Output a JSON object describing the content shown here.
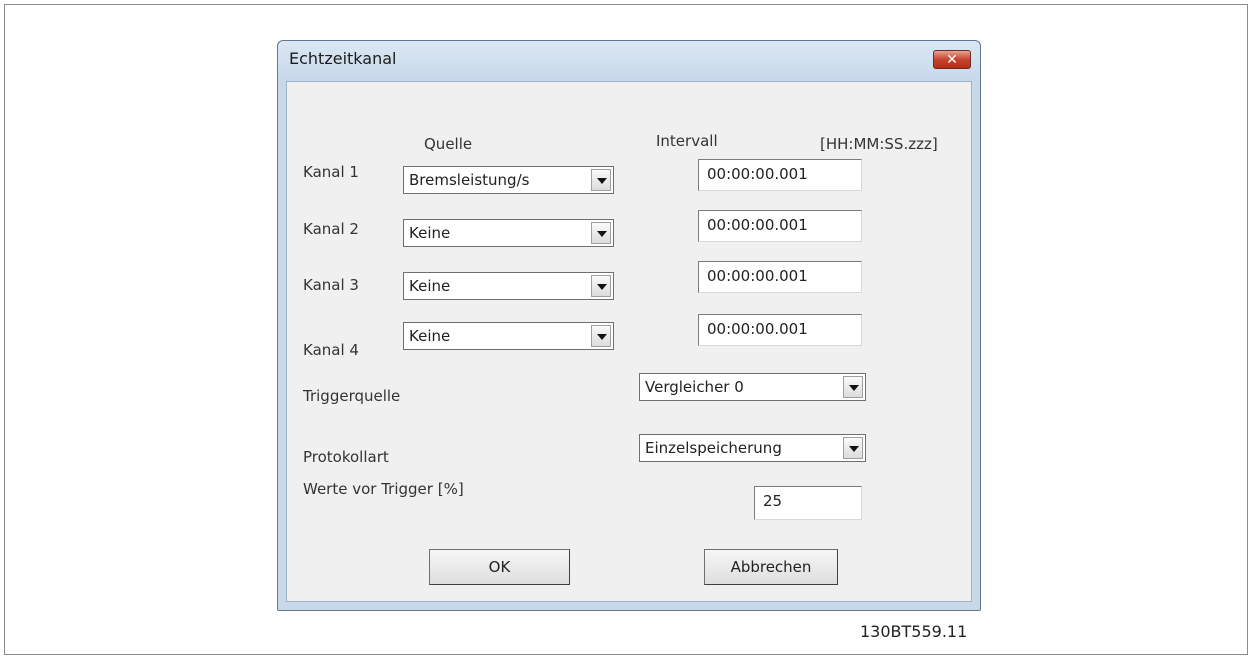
{
  "dialog": {
    "title": "Echtzeitkanal",
    "close_glyph": "✕"
  },
  "headers": {
    "source": "Quelle",
    "interval": "Intervall",
    "format": "[HH:MM:SS.zzz]"
  },
  "channels": [
    {
      "label": "Kanal 1",
      "source": "Bremsleistung/s",
      "interval": "00:00:00.001"
    },
    {
      "label": "Kanal 2",
      "source": "Keine",
      "interval": "00:00:00.001"
    },
    {
      "label": "Kanal 3",
      "source": "Keine",
      "interval": "00:00:00.001"
    },
    {
      "label": "Kanal 4",
      "source": "Keine",
      "interval": "00:00:00.001"
    }
  ],
  "trigger_source": {
    "label": "Triggerquelle",
    "value": "Vergleicher 0"
  },
  "log_type": {
    "label": "Protokollart",
    "value": "Einzelspeicherung"
  },
  "pre_trigger": {
    "label": "Werte vor Trigger [%]",
    "value": "25"
  },
  "buttons": {
    "ok": "OK",
    "cancel": "Abbrechen"
  },
  "figure_ref": "130BT559.11",
  "icons": {
    "close": "close-icon",
    "dropdown": "chevron-down-icon"
  }
}
